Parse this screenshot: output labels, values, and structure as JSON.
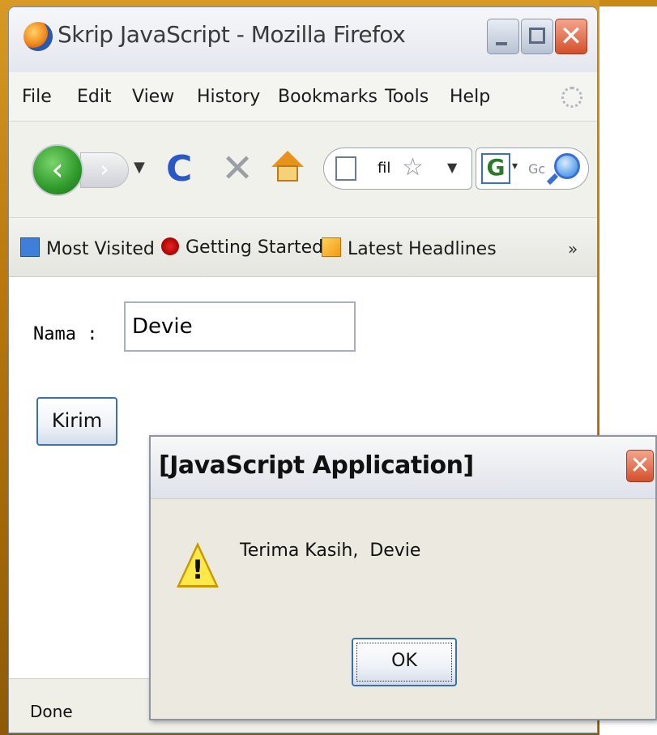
{
  "window": {
    "title": "Skrip JavaScript - Mozilla Firefox"
  },
  "menu": [
    "File",
    "Edit",
    "View",
    "History",
    "Bookmarks",
    "Tools",
    "Help"
  ],
  "navbar": {
    "url_text": "fil",
    "search_placeholder": "Gc",
    "reload_glyph": "C",
    "stop_glyph": "✕"
  },
  "bookmarks": {
    "items": [
      "Most Visited",
      "Getting Started",
      "Latest Headlines"
    ],
    "overflow": "»"
  },
  "form": {
    "label": "Nama :",
    "input_value": "Devie",
    "submit_label": "Kirim"
  },
  "status": {
    "text": "Done"
  },
  "alert": {
    "title": "[JavaScript Application]",
    "message": "Terima Kasih,  Devie",
    "ok_label": "OK"
  },
  "colors": {
    "background": "#c9820a",
    "accent": "#3c6fb0",
    "close_red": "#d3502c"
  }
}
